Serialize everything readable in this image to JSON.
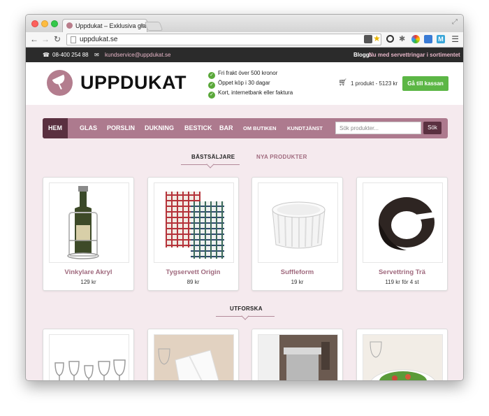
{
  "browser": {
    "tab_title": "Uppdukat – Exklusiva glas",
    "tab_close": "×",
    "url": "uppdukat.se"
  },
  "topbar": {
    "phone": "08-400 254 88",
    "email": "kundservice@uppdukat.se",
    "blog_label": "Blogg:",
    "blog_text": "Nu med servettringar i sortimentet"
  },
  "header": {
    "logo_text": "UPPDUKAT",
    "usps": [
      "Fri frakt över 500 kronor",
      "Öppet köp i 30 dagar",
      "Kort, internetbank eller faktura"
    ],
    "cart_text": "1 produkt - 5123 kr",
    "checkout_label": "Gå till kassan"
  },
  "nav": {
    "items": [
      "Hem",
      "Glas",
      "Porslin",
      "Dukning",
      "Bestick",
      "Bar",
      "Om butiken",
      "Kundtjänst"
    ],
    "search_placeholder": "Sök produkter...",
    "search_button": "Sök"
  },
  "sections": {
    "bestsellers": "BÄSTSÄLJARE",
    "new_products": "NYA PRODUKTER",
    "explore": "UTFORSKA"
  },
  "products": [
    {
      "name": "Vinkylare Akryl",
      "price": "129 kr"
    },
    {
      "name": "Tygservett Origin",
      "price": "89 kr"
    },
    {
      "name": "Suffleform",
      "price": "19 kr"
    },
    {
      "name": "Servettring Trä",
      "price": "119 kr för 4 st"
    }
  ],
  "colors": {
    "brand": "#ad7a8e",
    "brand_dark": "#5a3040",
    "checkout": "#5cb645",
    "page_bg": "#f5eaee"
  }
}
